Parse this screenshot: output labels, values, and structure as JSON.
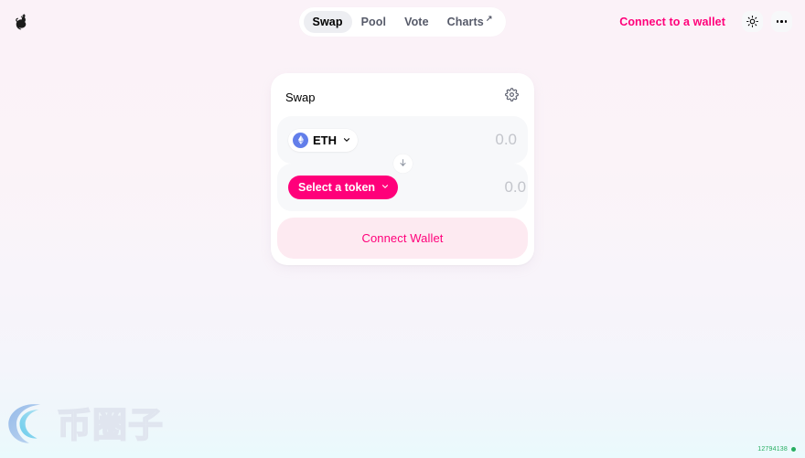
{
  "app": {
    "logo_icon": "unicorn-logo"
  },
  "nav": {
    "items": [
      {
        "label": "Swap",
        "active": true,
        "external": false
      },
      {
        "label": "Pool",
        "active": false,
        "external": false
      },
      {
        "label": "Vote",
        "active": false,
        "external": false
      },
      {
        "label": "Charts",
        "active": false,
        "external": true,
        "external_glyph": "↗"
      }
    ]
  },
  "header": {
    "connect_label": "Connect to a wallet",
    "theme_toggle_icon": "sun-icon",
    "more_menu_icon": "three-dots-icon"
  },
  "card": {
    "title": "Swap",
    "settings_icon": "gear-icon",
    "from": {
      "token_symbol": "ETH",
      "token_logo_icon": "ethereum-icon",
      "chevron_icon": "chevron-down-icon",
      "amount_value": "",
      "amount_placeholder": "0.0"
    },
    "switch_icon": "arrow-down-icon",
    "to": {
      "token_symbol": "Select a token",
      "chevron_icon": "chevron-down-icon",
      "amount_value": "",
      "amount_placeholder": "0.0"
    },
    "action_label": "Connect Wallet"
  },
  "watermark": {
    "text": "币圈子",
    "icon": "swirl-logo-icon"
  },
  "status": {
    "block_number": "12794138",
    "indicator_icon": "green-dot-icon"
  },
  "colors": {
    "accent_pink": "#ff007a",
    "accent_pink_soft": "#fdeaf1",
    "eth_blue": "#627eea",
    "status_green": "#27ae60",
    "row_bg": "#f7f8fa"
  }
}
